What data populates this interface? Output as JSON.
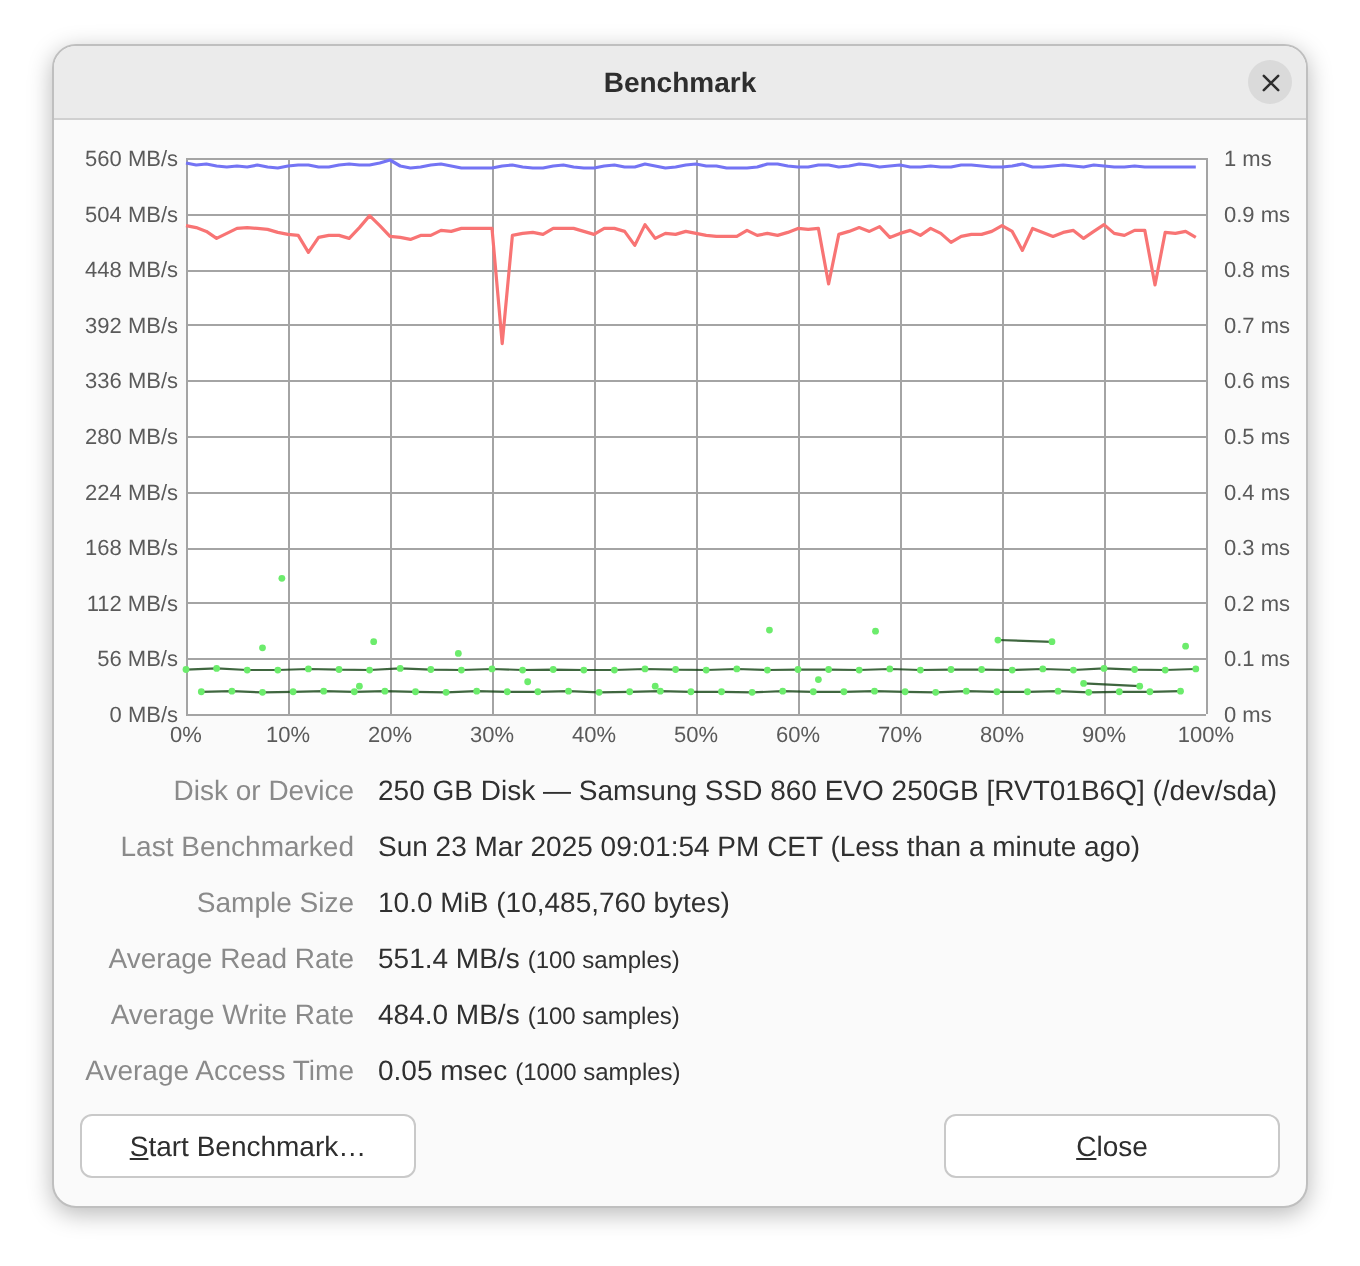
{
  "window": {
    "title": "Benchmark"
  },
  "chart": {
    "chart_data": {
      "type": "line",
      "grid": true,
      "xlim": [
        0,
        100
      ],
      "ylim": [
        0,
        560
      ],
      "xticks": [
        {
          "value": 0,
          "label": "0%"
        },
        {
          "value": 10,
          "label": "10%"
        },
        {
          "value": 20,
          "label": "20%"
        },
        {
          "value": 30,
          "label": "30%"
        },
        {
          "value": 40,
          "label": "40%"
        },
        {
          "value": 50,
          "label": "50%"
        },
        {
          "value": 60,
          "label": "60%"
        },
        {
          "value": 70,
          "label": "70%"
        },
        {
          "value": 80,
          "label": "80%"
        },
        {
          "value": 90,
          "label": "90%"
        },
        {
          "value": 100,
          "label": "100%"
        }
      ],
      "yticks": [
        {
          "value": 0,
          "label": "0 MB/s"
        },
        {
          "value": 56,
          "label": "56 MB/s"
        },
        {
          "value": 112,
          "label": "112 MB/s"
        },
        {
          "value": 168,
          "label": "168 MB/s"
        },
        {
          "value": 224,
          "label": "224 MB/s"
        },
        {
          "value": 280,
          "label": "280 MB/s"
        },
        {
          "value": 336,
          "label": "336 MB/s"
        },
        {
          "value": 392,
          "label": "392 MB/s"
        },
        {
          "value": 448,
          "label": "448 MB/s"
        },
        {
          "value": 504,
          "label": "504 MB/s"
        },
        {
          "value": 560,
          "label": "560 MB/s"
        }
      ],
      "x": [
        0,
        1,
        2,
        3,
        4,
        5,
        6,
        7,
        8,
        9,
        10,
        11,
        12,
        13,
        14,
        15,
        16,
        17,
        18,
        19,
        20,
        21,
        22,
        23,
        24,
        25,
        26,
        27,
        28,
        29,
        30,
        31,
        32,
        33,
        34,
        35,
        36,
        37,
        38,
        39,
        40,
        41,
        42,
        43,
        44,
        45,
        46,
        47,
        48,
        49,
        50,
        51,
        52,
        53,
        54,
        55,
        56,
        57,
        58,
        59,
        60,
        61,
        62,
        63,
        64,
        65,
        66,
        67,
        68,
        69,
        70,
        71,
        72,
        73,
        74,
        75,
        76,
        77,
        78,
        79,
        80,
        81,
        82,
        83,
        84,
        85,
        86,
        87,
        88,
        89,
        90,
        91,
        92,
        93,
        94,
        95,
        96,
        97,
        98,
        99
      ],
      "series": [
        {
          "color": "#7474f4",
          "values": [
            555,
            553,
            554,
            552,
            551,
            552,
            551,
            553,
            551,
            550,
            552,
            553,
            553,
            551,
            551,
            553,
            554,
            553,
            553,
            555,
            558,
            552,
            550,
            551,
            553,
            554,
            552,
            550,
            550,
            550,
            550,
            552,
            553,
            551,
            550,
            550,
            552,
            553,
            551,
            550,
            550,
            552,
            553,
            551,
            551,
            554,
            552,
            550,
            551,
            553,
            554,
            552,
            552,
            550,
            550,
            550,
            551,
            554,
            554,
            552,
            551,
            551,
            553,
            553,
            551,
            552,
            554,
            553,
            551,
            552,
            553,
            551,
            551,
            552,
            551,
            551,
            553,
            553,
            552,
            551,
            551,
            552,
            554,
            551,
            551,
            552,
            553,
            552,
            551,
            553,
            552,
            551,
            551,
            552,
            551,
            551,
            551,
            551,
            551,
            551
          ]
        },
        {
          "color": "#f87474",
          "values": [
            492,
            490,
            486,
            479,
            484,
            489,
            490,
            489,
            488,
            485,
            483,
            482,
            465,
            480,
            482,
            482,
            479,
            490,
            502,
            492,
            481,
            480,
            478,
            482,
            482,
            487,
            486,
            489,
            489,
            489,
            489,
            373,
            482,
            484,
            485,
            483,
            489,
            489,
            489,
            486,
            483,
            489,
            489,
            486,
            472,
            493,
            479,
            484,
            483,
            486,
            484,
            482,
            481,
            481,
            481,
            487,
            482,
            484,
            482,
            485,
            489,
            488,
            489,
            433,
            483,
            486,
            490,
            486,
            491,
            480,
            484,
            487,
            482,
            489,
            484,
            475,
            481,
            483,
            483,
            486,
            492,
            486,
            467,
            489,
            485,
            481,
            485,
            487,
            479,
            486,
            493,
            484,
            482,
            487,
            487,
            432,
            485,
            484,
            486,
            480
          ]
        }
      ]
    }
  },
  "access_chart": {
    "chart_data": {
      "type": "scatter",
      "xlim": [
        0,
        100
      ],
      "ylim": [
        0,
        1
      ],
      "yticks": [
        {
          "value": 0,
          "label": "0 ms"
        },
        {
          "value": 0.1,
          "label": "0.1 ms"
        },
        {
          "value": 0.2,
          "label": "0.2 ms"
        },
        {
          "value": 0.3,
          "label": "0.3 ms"
        },
        {
          "value": 0.4,
          "label": "0.4 ms"
        },
        {
          "value": 0.5,
          "label": "0.5 ms"
        },
        {
          "value": 0.6,
          "label": "0.6 ms"
        },
        {
          "value": 0.7,
          "label": "0.7 ms"
        },
        {
          "value": 0.8,
          "label": "0.8 ms"
        },
        {
          "value": 0.9,
          "label": "0.9 ms"
        },
        {
          "value": 1,
          "label": "1 ms"
        }
      ],
      "x": [
        0,
        3,
        6,
        9,
        12,
        15,
        18,
        21,
        24,
        27,
        30,
        33,
        36,
        39,
        42,
        45,
        48,
        51,
        54,
        57,
        60,
        63,
        66,
        69,
        72,
        75,
        78,
        81,
        84,
        87,
        90,
        93,
        96,
        99,
        1.5,
        4.5,
        7.5,
        10.5,
        13.5,
        16.5,
        19.5,
        22.5,
        25.5,
        28.5,
        31.5,
        34.5,
        37.5,
        40.5,
        43.5,
        46.5,
        49.5,
        52.5,
        55.5,
        58.5,
        61.5,
        64.5,
        67.5,
        70.5,
        73.5,
        76.5,
        79.5,
        82.5,
        85.5,
        88.5,
        91.5,
        94.5,
        97.5,
        7.5,
        9.4,
        17,
        18.4,
        26.7,
        33.5,
        46,
        57.2,
        62,
        67.6,
        79.6,
        84.9,
        88,
        93.5,
        98
      ],
      "series": [
        {
          "color": "#6cec6c",
          "values": [
            0.08,
            0.082,
            0.079,
            0.079,
            0.081,
            0.08,
            0.079,
            0.082,
            0.08,
            0.079,
            0.081,
            0.079,
            0.08,
            0.079,
            0.079,
            0.081,
            0.08,
            0.079,
            0.081,
            0.079,
            0.08,
            0.08,
            0.079,
            0.081,
            0.079,
            0.08,
            0.08,
            0.079,
            0.081,
            0.079,
            0.082,
            0.08,
            0.079,
            0.081,
            0.04,
            0.041,
            0.039,
            0.04,
            0.041,
            0.04,
            0.041,
            0.04,
            0.039,
            0.041,
            0.04,
            0.04,
            0.041,
            0.039,
            0.04,
            0.041,
            0.04,
            0.04,
            0.039,
            0.041,
            0.04,
            0.04,
            0.041,
            0.04,
            0.039,
            0.041,
            0.04,
            0.04,
            0.041,
            0.039,
            0.04,
            0.04,
            0.041,
            0.119,
            0.244,
            0.05,
            0.13,
            0.109,
            0.058,
            0.05,
            0.151,
            0.062,
            0.149,
            0.133,
            0.13,
            0.055,
            0.05,
            0.122
          ]
        }
      ]
    }
  },
  "details": [
    {
      "label": "Disk or Device",
      "value": "250 GB Disk — Samsung SSD 860 EVO 250GB [RVT01B6Q] (/dev/sda)"
    },
    {
      "label": "Last Benchmarked",
      "value": "Sun 23 Mar 2025 09:01:54 PM CET (Less than a minute ago)"
    },
    {
      "label": "Sample Size",
      "value": "10.0 MiB (10,485,760 bytes)"
    },
    {
      "label": "Average Read Rate",
      "value": "551.4 MB/s",
      "note": "(100 samples)"
    },
    {
      "label": "Average Write Rate",
      "value": "484.0 MB/s",
      "note": "(100 samples)"
    },
    {
      "label": "Average Access Time",
      "value": "0.05 msec",
      "note": "(1000 samples)"
    }
  ],
  "buttons": [
    {
      "label": "Start Benchmark…",
      "mnemonic": true
    },
    {
      "label": "Close",
      "mnemonic": true
    }
  ]
}
